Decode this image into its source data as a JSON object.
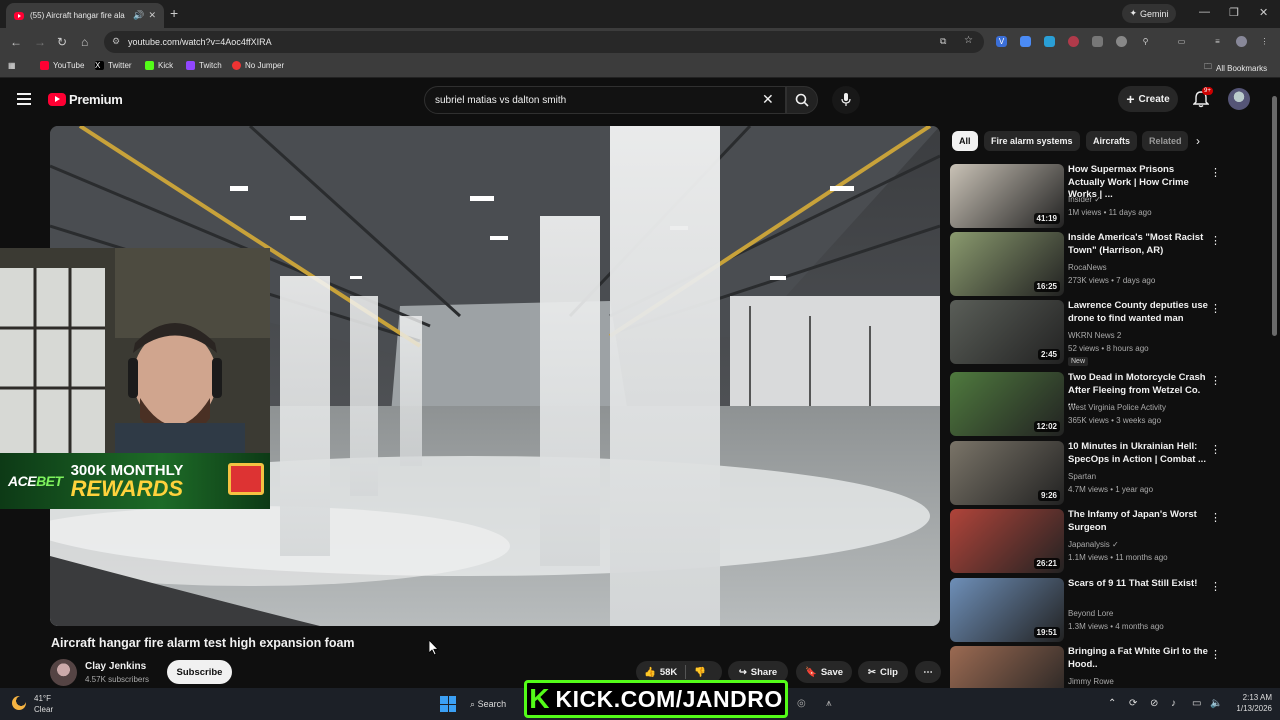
{
  "browser": {
    "tab_title": "(55) Aircraft hangar fire ala",
    "tab_audio_icon": "speaker-icon",
    "gemini_label": "Gemini",
    "url": "youtube.com/watch?v=4Aoc4ffXIRA",
    "bookmarks": [
      "YouTube",
      "Twitter",
      "Kick",
      "Twitch",
      "No Jumper"
    ],
    "all_bookmarks": "All Bookmarks"
  },
  "yt": {
    "premium_label": "Premium",
    "search_value": "subriel matias vs dalton smith",
    "create_label": "Create",
    "notif_count": "9+"
  },
  "video": {
    "title": "Aircraft hangar fire alarm test high expansion foam",
    "channel": "Clay Jenkins",
    "subscribers": "4.57K subscribers",
    "subscribe_label": "Subscribe",
    "likes": "58K",
    "share_label": "Share",
    "save_label": "Save",
    "clip_label": "Clip"
  },
  "overlay": {
    "acebet_logo_a": "ACE",
    "acebet_logo_b": "BET",
    "acebet_top": "300K MONTHLY",
    "acebet_bottom": "REWARDS",
    "kick_k": "K",
    "kick_text": "KICK.COM/JANDRO"
  },
  "chips": [
    "All",
    "Fire alarm systems",
    "Aircrafts",
    "Related"
  ],
  "recommendations": [
    {
      "title": "How Supermax Prisons Actually Work | How Crime Works | ...",
      "channel": "Insider",
      "verified": true,
      "meta": "1M views • 11 days ago",
      "duration": "41:19",
      "thumb_color": "#c9c2b6"
    },
    {
      "title": "Inside America's \"Most Racist Town\" (Harrison, AR)",
      "channel": "RocaNews",
      "verified": false,
      "meta": "273K views • 7 days ago",
      "duration": "16:25",
      "thumb_color": "#8a9a6e"
    },
    {
      "title": "Lawrence County deputies use drone to find wanted man",
      "channel": "WKRN News 2",
      "verified": false,
      "meta": "52 views • 8 hours ago",
      "duration": "2:45",
      "badge": "New",
      "thumb_color": "#5a5e58"
    },
    {
      "title": "Two Dead in Motorcycle Crash After Fleeing from Wetzel Co. ...",
      "channel": "West Virginia Police Activity",
      "verified": false,
      "meta": "365K views • 3 weeks ago",
      "duration": "12:02",
      "thumb_color": "#4f7a3e"
    },
    {
      "title": "10 Minutes in Ukrainian Hell: SpecOps in Action | Combat ...",
      "channel": "Spartan",
      "verified": false,
      "meta": "4.7M views • 1 year ago",
      "duration": "9:26",
      "thumb_color": "#7a7468"
    },
    {
      "title": "The Infamy of Japan's Worst Surgeon",
      "channel": "Japanalysis",
      "verified": true,
      "meta": "1.1M views • 11 months ago",
      "duration": "26:21",
      "thumb_color": "#b0443a"
    },
    {
      "title": "Scars of 9 11 That Still Exist!",
      "channel": "Beyond Lore",
      "verified": false,
      "meta": "1.3M views • 4 months ago",
      "duration": "19:51",
      "thumb_color": "#6e8fb8"
    },
    {
      "title": "Bringing a Fat White Girl to the Hood..",
      "channel": "Jimmy Rowe",
      "verified": false,
      "meta": "",
      "duration": "",
      "thumb_color": "#9b6a52"
    }
  ],
  "taskbar": {
    "temp": "41°F",
    "condition": "Clear",
    "search_label": "Search",
    "time": "2:13 AM",
    "date": "1/13/2026"
  }
}
